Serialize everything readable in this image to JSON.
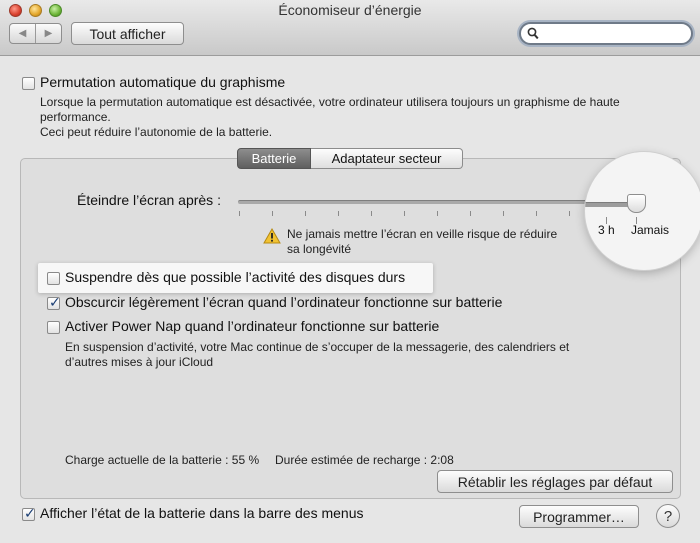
{
  "window": {
    "title": "Économiseur d’énergie"
  },
  "toolbar": {
    "back_icon": "◀",
    "forward_icon": "▶",
    "show_all_label": "Tout afficher",
    "search_placeholder": ""
  },
  "graphics_switching": {
    "checked": false,
    "label": "Permutation automatique du graphisme",
    "description_line1": "Lorsque la permutation automatique est désactivée, votre ordinateur utilisera toujours un graphisme de haute",
    "description_line2": "performance.",
    "description_line3": "Ceci peut réduire l’autonomie de la batterie."
  },
  "tabs": [
    {
      "label": "Batterie",
      "selected": true
    },
    {
      "label": "Adaptateur secteur",
      "selected": false
    }
  ],
  "display_sleep": {
    "label": "Éteindre l’écran après :",
    "value": "Jamais",
    "warning_line1": "Ne jamais mettre l’écran en veille risque de réduire",
    "warning_line2": "sa longévité",
    "tick_labels": {
      "three_hours": "3 h",
      "never": "Jamais"
    }
  },
  "options": [
    {
      "label": "Suspendre dès que possible l’activité des disques durs",
      "checked": false
    },
    {
      "label": "Obscurcir légèrement l’écran quand l’ordinateur fonctionne sur batterie",
      "checked": true
    },
    {
      "label": "Activer Power Nap quand l’ordinateur fonctionne sur batterie",
      "checked": false
    }
  ],
  "power_nap_description_line1": "En suspension d’activité, votre Mac continue de s’occuper de la messagerie, des calendriers et",
  "power_nap_description_line2": "d’autres mises à jour iCloud",
  "battery_status": {
    "charge_text": "Charge actuelle de la batterie : 55 %",
    "recharge_text": "Durée estimée de recharge : 2:08"
  },
  "restore_defaults_label": "Rétablir les réglages par défaut",
  "menu_bar_option": {
    "label": "Afficher l’état de la batterie dans la barre des menus",
    "checked": true
  },
  "schedule_label": "Programmer…",
  "help_label": "?",
  "icons": {
    "search": "magnifier-icon",
    "warning": "warning-triangle-icon"
  }
}
